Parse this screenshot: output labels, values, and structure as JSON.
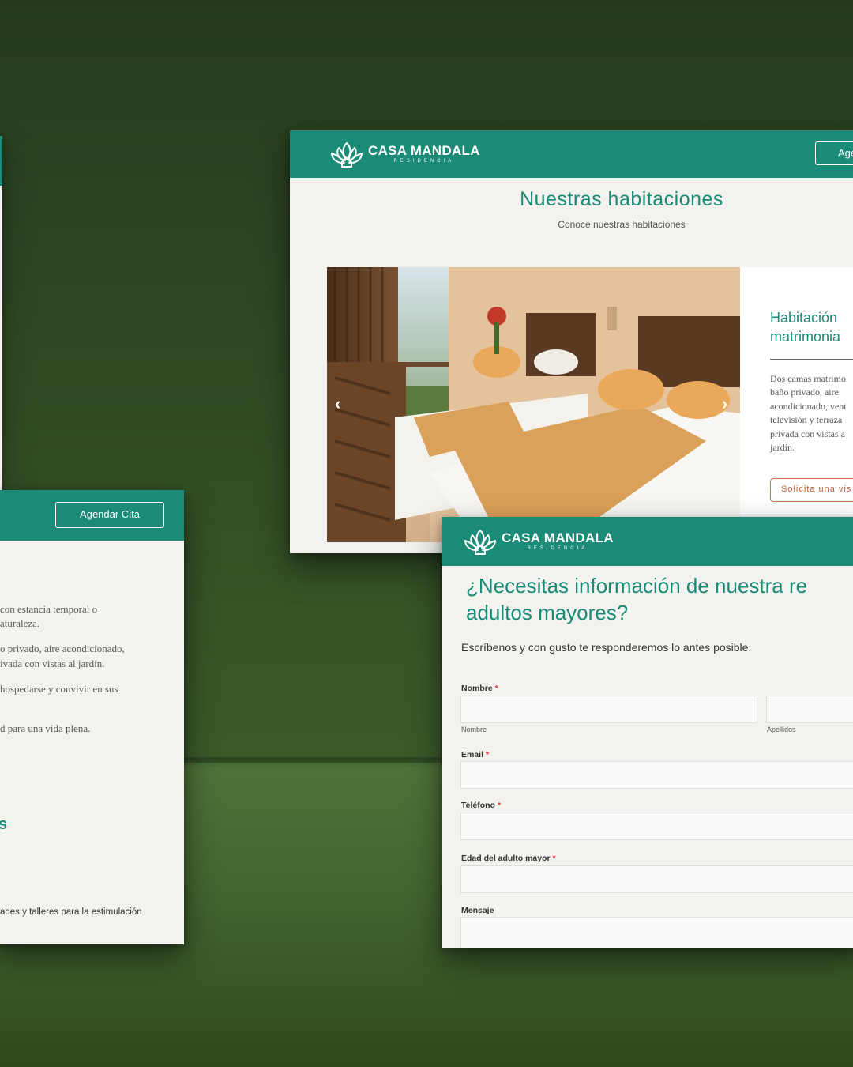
{
  "brand": {
    "name": "CASA MANDALA",
    "subtitle": "RESIDENCIA"
  },
  "left_panel": {
    "cta_label": "Agendar Cita",
    "text_lines": [
      "con estancia temporal o",
      "aturaleza.",
      "o privado, aire acondicionado,",
      "ivada con vistas al jardín.",
      " hospedarse y convivir en sus",
      "d para una vida plena."
    ],
    "heading_fragment": "s",
    "small_text": "ades y talleres para la estimulación"
  },
  "rooms_page": {
    "header_button": "Age",
    "title": "Nuestras habitaciones",
    "subtitle": "Conoce nuestras habitaciones",
    "carousel": {
      "prev_icon": "chevron-left-icon",
      "next_icon": "chevron-right-icon"
    },
    "room_card": {
      "title_lines": [
        "Habitación",
        "matrimonia"
      ],
      "description_lines": [
        "Dos camas matrimo",
        "baño privado, aire",
        "acondicionado, vent",
        "televisión y terraza",
        "privada con vistas a",
        "jardín."
      ],
      "button_label": "Solicita una vis"
    }
  },
  "form_page": {
    "title_lines": [
      "¿Necesitas información de nuestra re",
      "adultos mayores?"
    ],
    "intro": "Escríbenos y con gusto te responderemos lo antes posible.",
    "fields": {
      "name_label": "Nombre",
      "first_name_sub": "Nombre",
      "last_name_sub": "Apellidos",
      "email_label": "Email",
      "phone_label": "Teléfono",
      "age_label": "Edad del adulto mayor",
      "message_label": "Mensaje",
      "required_mark": "*"
    }
  },
  "colors": {
    "brand_teal": "#1a8b76",
    "accent_orange": "#d4754a",
    "panel_bg": "#f4f2ee",
    "background_green": "#2f4a22"
  }
}
